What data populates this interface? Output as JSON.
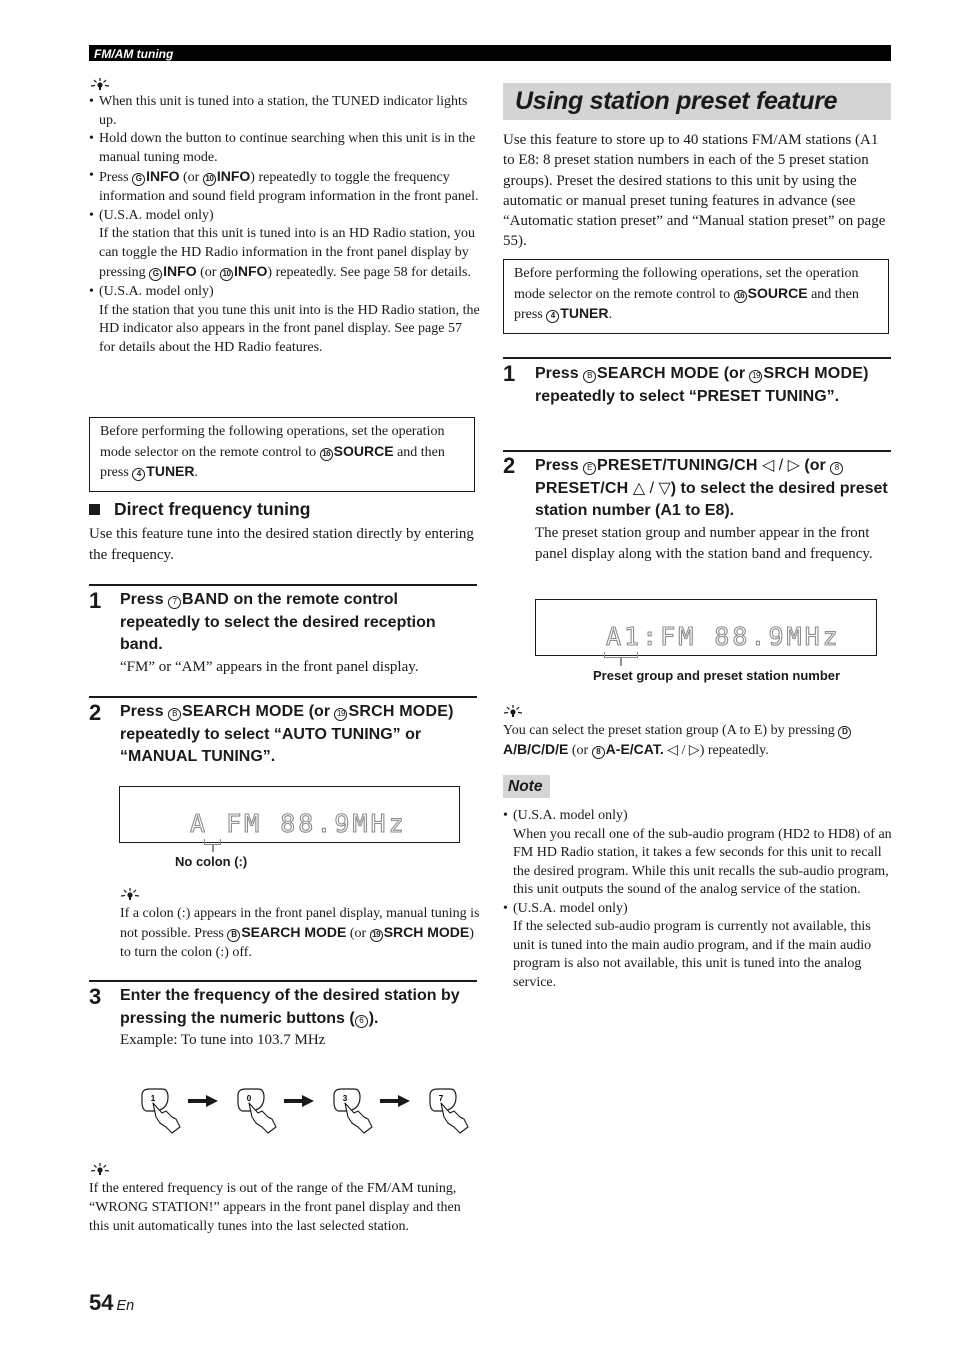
{
  "header": {
    "section": "FM/AM tuning"
  },
  "icons": {
    "tip": "tip-lightbulb-icon"
  },
  "left": {
    "tips": [
      {
        "text": "When this unit is tuned into a station, the TUNED indicator lights up."
      },
      {
        "text": "Hold down the button to continue searching when this unit is in the manual tuning mode."
      },
      {
        "pre": "Press ",
        "k1_num": "G",
        "k1": "INFO",
        "mid": " (or ",
        "k2_num": "10",
        "k2": "INFO",
        "post": ") repeatedly to toggle the frequency information and sound field program information in the front panel."
      },
      {
        "line1": "(U.S.A. model only)",
        "pre": "If the station that this unit is tuned into is an HD Radio station, you can toggle the HD Radio information in the front panel display by pressing ",
        "k1_num": "G",
        "k1": "INFO",
        "mid": " (or ",
        "k2_num": "10",
        "k2": "INFO",
        "post": ") repeatedly. See page 58 for details."
      },
      {
        "line1": "(U.S.A. model only)",
        "text": "If the station that you tune this unit into is the HD Radio station, the HD indicator also appears in the front panel display. See page 57 for details about the HD Radio features."
      }
    ],
    "notice": {
      "pre": "Before performing the following operations, set the operation mode selector on the remote control to ",
      "k1_num": "16",
      "k1": "SOURCE",
      "mid": " and then press ",
      "k2_num": "4",
      "k2": "TUNER",
      "post": "."
    },
    "section_title": "Direct frequency tuning",
    "section_intro": "Use this feature tune into the desired station directly by entering the frequency.",
    "steps": [
      {
        "num": "1",
        "pre": "Press ",
        "k1_num": "7",
        "k1": "BAND",
        "post": " on the remote control repeatedly to select the desired reception band.",
        "body": "“FM” or “AM” appears in the front panel display."
      },
      {
        "num": "2",
        "pre": "Press ",
        "k1_num": "B",
        "k1": "SEARCH MODE",
        "mid": " (or ",
        "k2_num": "19",
        "k2": "SRCH MODE",
        "post": ") repeatedly to select “AUTO TUNING” or “MANUAL TUNING”."
      },
      {
        "num": "3",
        "title": "Enter the frequency of the desired station by pressing the numeric buttons (",
        "k1_num": "6",
        "post": ").",
        "body": "Example: To tune into 103.7 MHz"
      }
    ],
    "display": {
      "text": "A FM 88.9MHz",
      "caption": "No colon (:)"
    },
    "colon_tip": {
      "pre": "If a colon (:) appears in the front panel display, manual tuning is not possible. Press ",
      "k1_num": "B",
      "k1": "SEARCH MODE",
      "mid": " (or ",
      "k2_num": "19",
      "k2": "SRCH MODE",
      "post": ") to turn the colon (:) off."
    },
    "key_sequence": [
      "1",
      "0",
      "3",
      "7"
    ],
    "range_tip": "If the entered frequency is out of the range of the FM/AM tuning, “WRONG STATION!” appears in the front panel display and then this unit automatically tunes into the last selected station."
  },
  "right": {
    "title": "Using station preset feature",
    "intro": "Use this feature to store up to 40 stations FM/AM stations (A1 to E8: 8 preset station numbers in each of the 5 preset station groups). Preset the desired stations to this unit by using the automatic or manual preset tuning features in advance (see “Automatic station preset” and “Manual station preset” on page 55).",
    "notice": {
      "pre": "Before performing the following operations, set the operation mode selector on the remote control to ",
      "k1_num": "16",
      "k1": "SOURCE",
      "mid": " and then press ",
      "k2_num": "4",
      "k2": "TUNER",
      "post": "."
    },
    "steps": [
      {
        "num": "1",
        "pre": "Press ",
        "k1_num": "B",
        "k1": "SEARCH MODE",
        "mid": " (or ",
        "k2_num": "19",
        "k2": "SRCH MODE",
        "post": ") repeatedly to select “PRESET TUNING”."
      },
      {
        "num": "2",
        "pre": "Press ",
        "k1_num": "E",
        "k1": "PRESET/TUNING/CH",
        "arrows1": " ◁ / ▷",
        "mid": " (or ",
        "k2_num": "8",
        "k2": "PRESET/CH",
        "arrows2": " △ / ▽",
        "post": ") to select the desired preset station number (A1 to E8).",
        "body": "The preset station group and number appear in the front panel display along with the station band and frequency."
      }
    ],
    "display": {
      "text": "A1:FM 88.9MHz",
      "caption": "Preset group and preset station number"
    },
    "group_tip": {
      "pre": "You can select the preset station group (A to E) by pressing ",
      "k1_num": "D",
      "k1": "A/B/C/D/E",
      "mid": " (or ",
      "k2_num": "8",
      "k2": "A-E/CAT.",
      "arrows": " ◁ / ▷",
      "post": ") repeatedly."
    },
    "note_label": "Note",
    "notes": [
      {
        "line1": "(U.S.A. model only)",
        "text": "When you recall one of the sub-audio program (HD2 to HD8) of an FM HD Radio station, it takes a few seconds for this unit to recall the desired program. While this unit recalls the sub-audio program, this unit outputs the sound of the analog service of the station."
      },
      {
        "line1": "(U.S.A. model only)",
        "text": "If the selected sub-audio program is currently not available, this unit is tuned into the main audio program, and if the main audio program is also not available, this unit is tuned into the analog service."
      }
    ]
  },
  "footer": {
    "page": "54",
    "lang": "En"
  }
}
